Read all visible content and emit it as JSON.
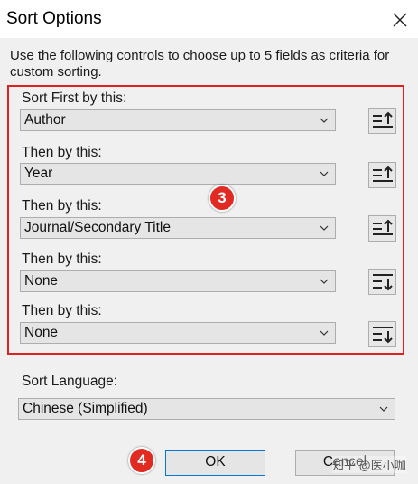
{
  "dialog": {
    "title": "Sort Options",
    "description": "Use the following controls to choose up to 5 fields as criteria for custom sorting."
  },
  "sort_fields": [
    {
      "label": "Sort First by this:",
      "value": "Author",
      "order": "ascending"
    },
    {
      "label": "Then by this:",
      "value": "Year",
      "order": "ascending"
    },
    {
      "label": "Then by this:",
      "value": "Journal/Secondary Title",
      "order": "ascending"
    },
    {
      "label": "Then by this:",
      "value": "None",
      "order": "descending"
    },
    {
      "label": "Then by this:",
      "value": "None",
      "order": "descending"
    }
  ],
  "language": {
    "label": "Sort Language:",
    "value": "Chinese (Simplified)"
  },
  "buttons": {
    "ok": "OK",
    "cancel": "Cancel"
  },
  "annotations": {
    "badge_3": "3",
    "badge_4": "4"
  },
  "watermark": "知乎 @医小咖",
  "colors": {
    "highlight_border": "#e02020",
    "badge": "#e02a22",
    "ok_border": "#0078d7"
  }
}
